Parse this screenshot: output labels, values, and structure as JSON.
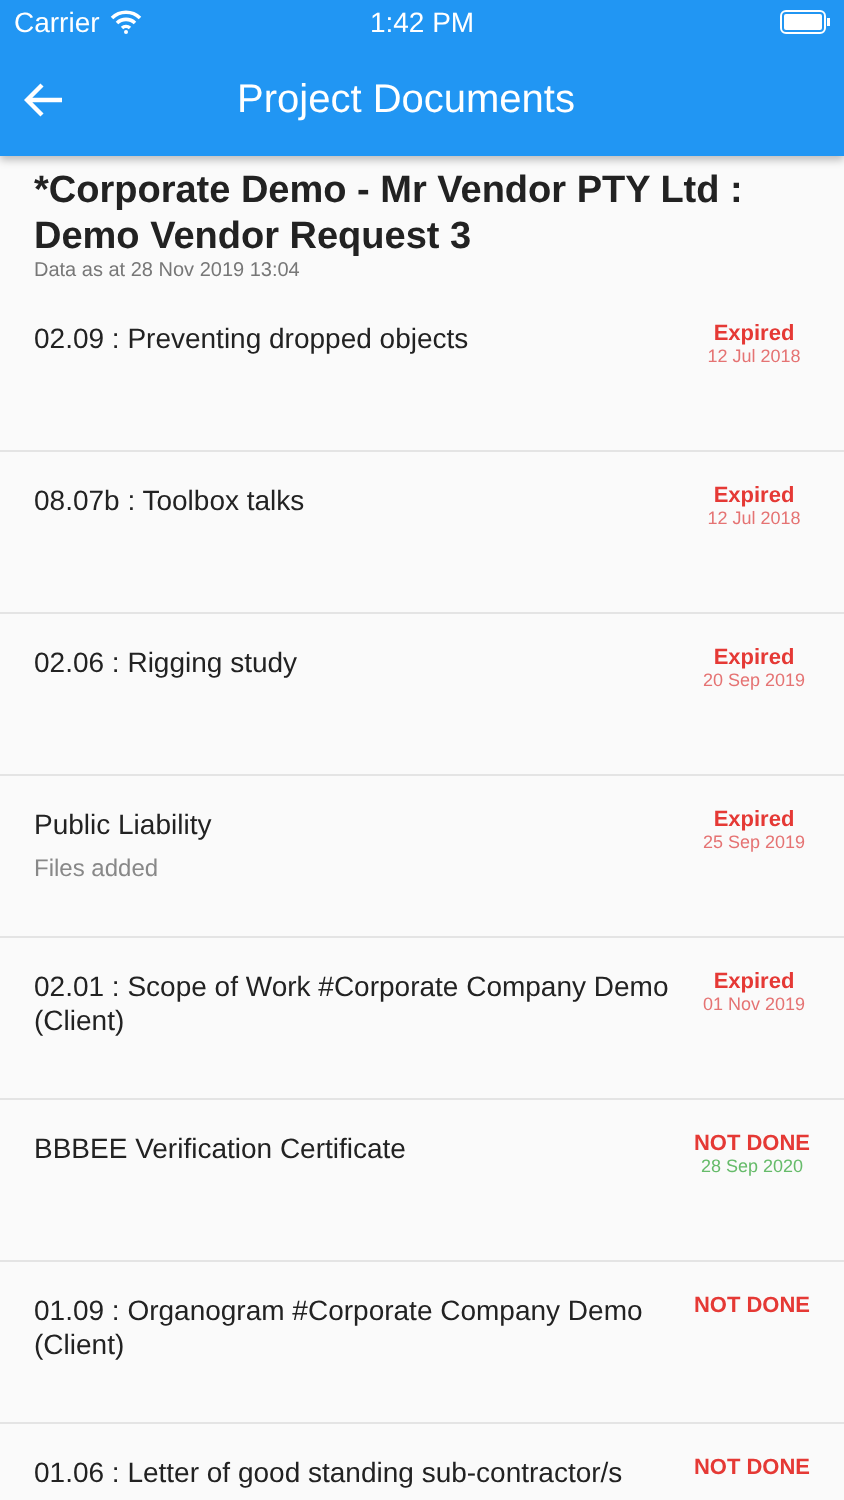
{
  "status_bar": {
    "carrier": "Carrier",
    "time": "1:42 PM"
  },
  "app_bar": {
    "title": "Project Documents"
  },
  "header": {
    "title": "*Corporate Demo - Mr Vendor PTY Ltd : Demo Vendor Request 3",
    "subtitle": "Data as at 28 Nov 2019 13:04"
  },
  "documents": [
    {
      "name": "02.09 : Preventing dropped objects",
      "status": "Expired",
      "date": {
        "text": "12 Jul 2018",
        "kind": "expired"
      }
    },
    {
      "name": "08.07b : Toolbox talks",
      "status": "Expired",
      "date": {
        "text": "12 Jul 2018",
        "kind": "expired"
      }
    },
    {
      "name": "02.06 : Rigging study",
      "status": "Expired",
      "date": {
        "text": "20 Sep 2019",
        "kind": "expired"
      }
    },
    {
      "name": "Public Liability",
      "note": "Files added",
      "status": "Expired",
      "date": {
        "text": "25 Sep 2019",
        "kind": "expired"
      }
    },
    {
      "name": "02.01 : Scope of Work #Corporate Company Demo (Client)",
      "status": "Expired",
      "date": {
        "text": "01 Nov 2019",
        "kind": "expired"
      }
    },
    {
      "name": "BBBEE Verification Certificate",
      "status": "NOT DONE",
      "date": {
        "text": "28 Sep 2020",
        "kind": "valid"
      }
    },
    {
      "name": "01.09 : Organogram #Corporate Company Demo (Client)",
      "status": "NOT DONE"
    },
    {
      "name": "01.06 : Letter of good standing sub-contractor/s",
      "status": "NOT DONE"
    }
  ]
}
